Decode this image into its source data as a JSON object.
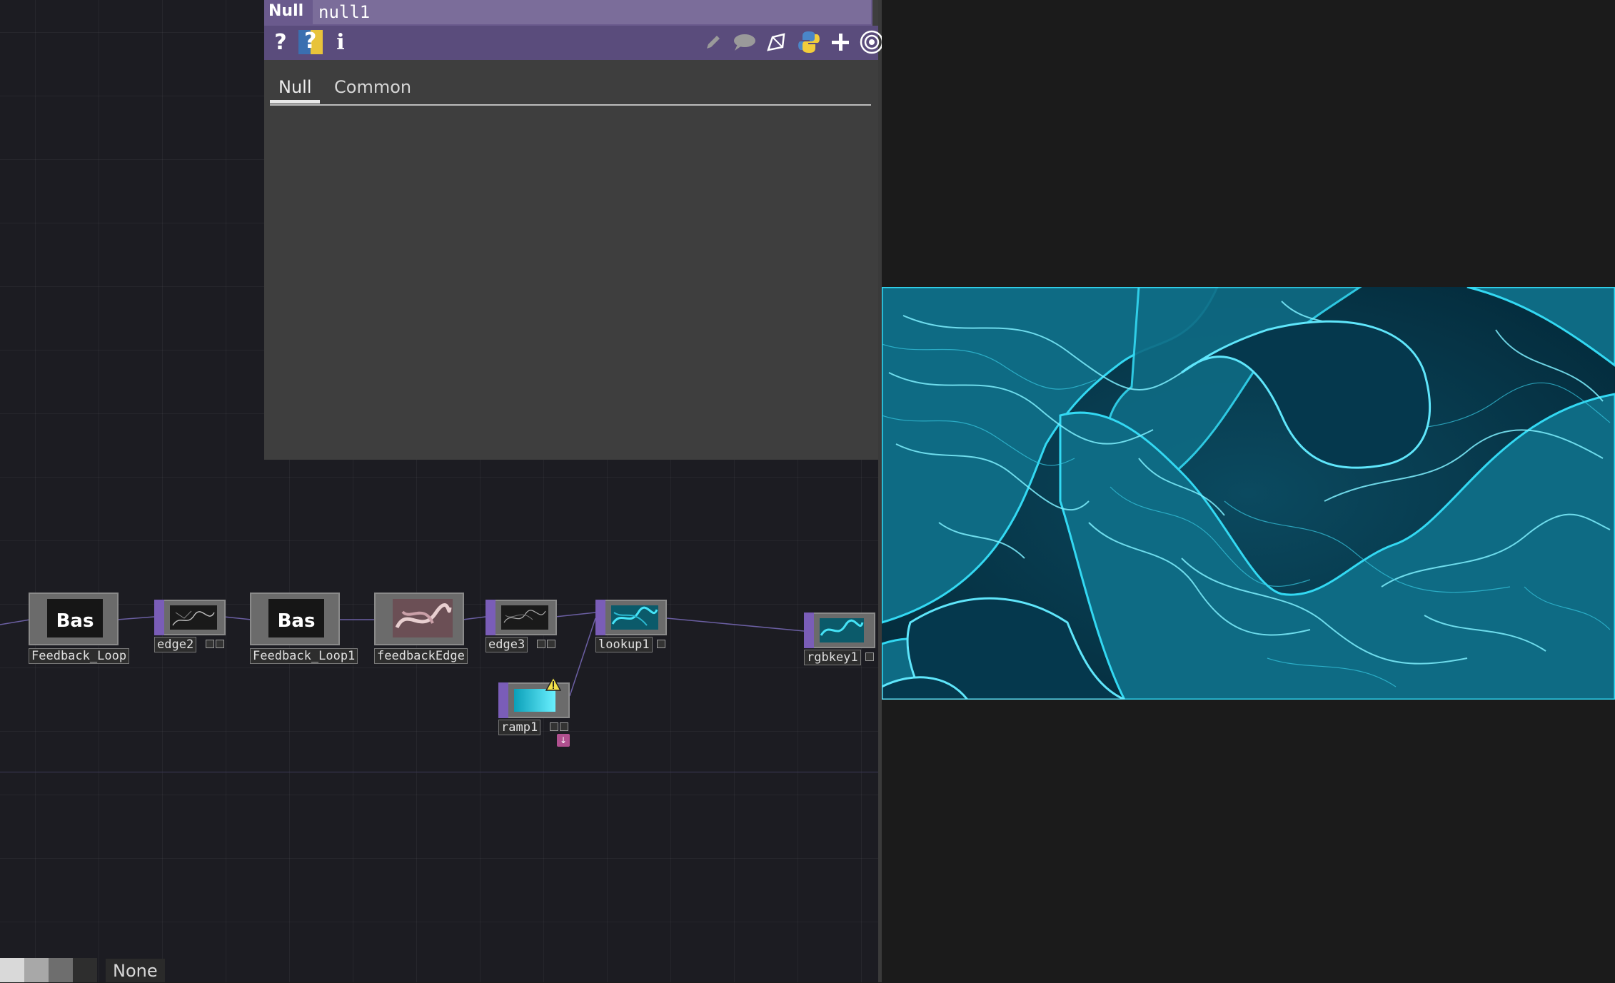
{
  "param_dialog": {
    "op_type": "Null",
    "op_name": "null1",
    "toolbar_left": [
      "help-icon",
      "python-help-icon",
      "info-icon"
    ],
    "toolbar_right": [
      "edit-icon",
      "comment-icon",
      "clone-icon",
      "python-icon",
      "add-icon",
      "target-icon"
    ],
    "tabs": [
      "Null",
      "Common"
    ],
    "active_tab": "Null"
  },
  "network": {
    "nodes": [
      {
        "id": "feedback-loop",
        "label": "Feedback_Loop",
        "thumb_text": "Bas"
      },
      {
        "id": "edge2",
        "label": "edge2"
      },
      {
        "id": "feedback-loop1",
        "label": "Feedback_Loop1",
        "thumb_text": "Bas"
      },
      {
        "id": "feedbackedge",
        "label": "feedbackEdge"
      },
      {
        "id": "edge3",
        "label": "edge3"
      },
      {
        "id": "lookup1",
        "label": "lookup1"
      },
      {
        "id": "ramp1",
        "label": "ramp1",
        "warning": true
      },
      {
        "id": "rgbkey1",
        "label": "rgbkey1"
      }
    ]
  },
  "palette": {
    "swatches": [
      "#d9d9d9",
      "#a8a8a8",
      "#6e6e6e",
      "#2e2e2e"
    ],
    "selected_label": "None"
  },
  "colors": {
    "accent_purple": "#6a5a8d",
    "viewer_cyan": "#2ad4f0",
    "viewer_dark": "#043448"
  }
}
